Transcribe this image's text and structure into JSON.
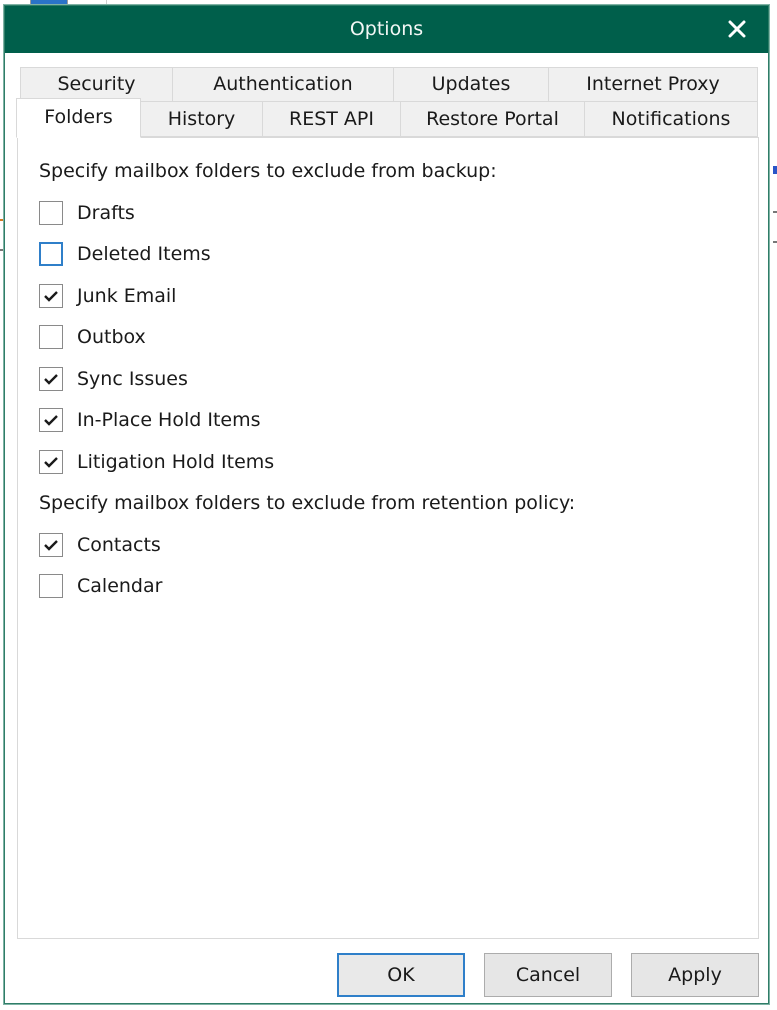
{
  "dialog": {
    "title": "Options",
    "close_icon": "close-icon",
    "accent_color": "#005f4b",
    "focus_color": "#2f7fc9"
  },
  "tabs": {
    "row1": [
      {
        "label": "Security",
        "selected": false
      },
      {
        "label": "Authentication",
        "selected": false
      },
      {
        "label": "Updates",
        "selected": false
      },
      {
        "label": "Internet Proxy",
        "selected": false
      }
    ],
    "row2": [
      {
        "label": "Folders",
        "selected": true
      },
      {
        "label": "History",
        "selected": false
      },
      {
        "label": "REST API",
        "selected": false
      },
      {
        "label": "Restore Portal",
        "selected": false
      },
      {
        "label": "Notifications",
        "selected": false
      }
    ]
  },
  "folders": {
    "backup_section_label": "Specify mailbox folders to exclude from backup:",
    "backup_items": [
      {
        "label": "Drafts",
        "checked": false
      },
      {
        "label": "Deleted Items",
        "checked": false,
        "focused": true
      },
      {
        "label": "Junk Email",
        "checked": true
      },
      {
        "label": "Outbox",
        "checked": false
      },
      {
        "label": "Sync Issues",
        "checked": true
      },
      {
        "label": "In-Place Hold Items",
        "checked": true
      },
      {
        "label": "Litigation Hold Items",
        "checked": true
      }
    ],
    "retention_section_label": "Specify mailbox folders to exclude from retention policy:",
    "retention_items": [
      {
        "label": "Contacts",
        "checked": true
      },
      {
        "label": "Calendar",
        "checked": false
      }
    ]
  },
  "buttons": {
    "ok_label": "OK",
    "cancel_label": "Cancel",
    "apply_label": "Apply"
  }
}
